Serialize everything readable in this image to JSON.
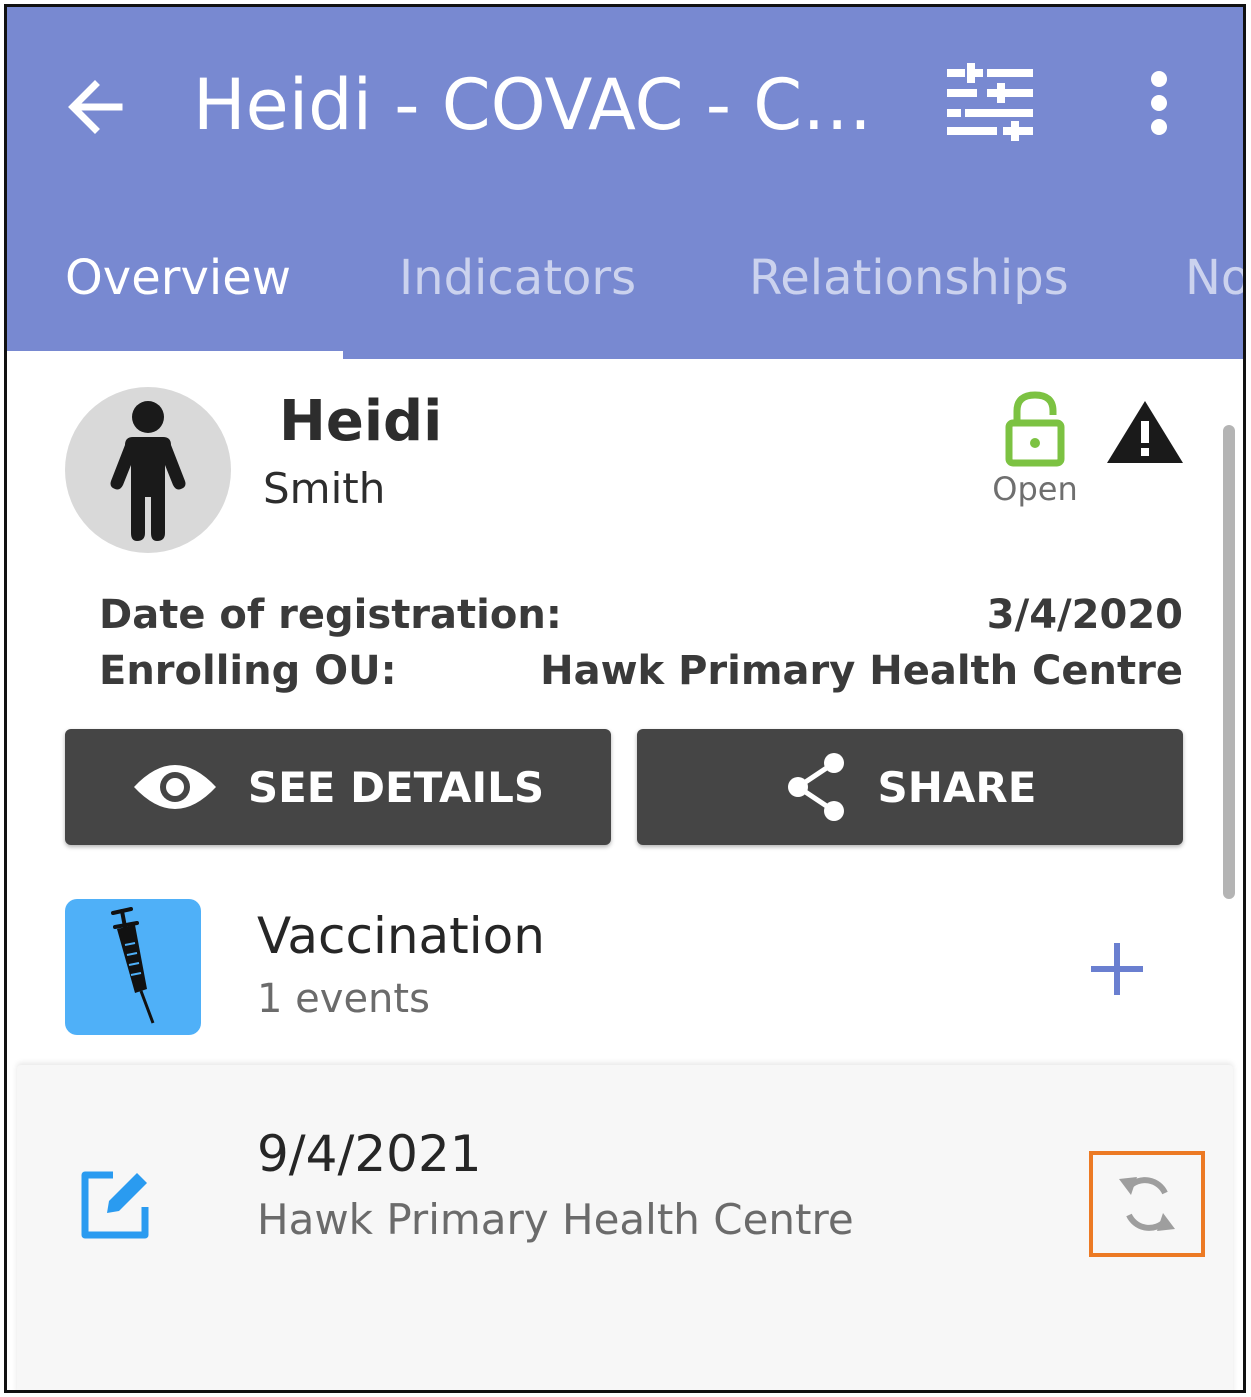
{
  "header": {
    "title": "Heidi - COVAC - CO..."
  },
  "tabs": [
    {
      "label": "Overview",
      "active": true
    },
    {
      "label": "Indicators",
      "active": false
    },
    {
      "label": "Relationships",
      "active": false
    },
    {
      "label": "No",
      "active": false
    }
  ],
  "profile": {
    "first_name": "Heidi",
    "last_name": "Smith",
    "status_label": "Open"
  },
  "enrollment": {
    "date_label": "Date of registration:",
    "date_value": "3/4/2020",
    "ou_label": "Enrolling OU:",
    "ou_value": "Hawk Primary Health Centre"
  },
  "actions": {
    "details_label": "SEE DETAILS",
    "share_label": "SHARE"
  },
  "program_stage": {
    "name": "Vaccination",
    "events": "1 events"
  },
  "event": {
    "date": "9/4/2021",
    "org_unit": "Hawk Primary Health Centre"
  },
  "colors": {
    "appbar": "#7889d1",
    "button": "#454545",
    "stage_icon_bg": "#4fb0f8",
    "open_lock": "#7cc242",
    "add": "#6a7fd0",
    "edit": "#2a9bf0",
    "sync_highlight": "#ec7a24"
  },
  "icons": [
    "back-arrow-icon",
    "filter-icon",
    "more-vert-icon",
    "person-icon",
    "lock-open-icon",
    "warning-icon",
    "eye-icon",
    "share-icon",
    "syringe-icon",
    "plus-icon",
    "edit-icon",
    "sync-icon"
  ]
}
